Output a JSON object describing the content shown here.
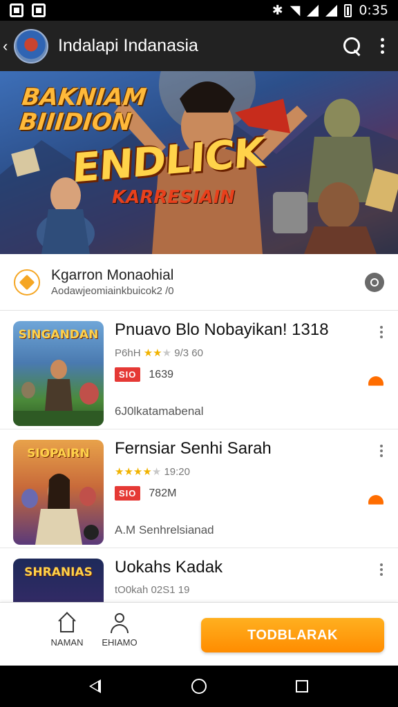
{
  "status_bar": {
    "time": "0:35",
    "icons": [
      "notification-icon",
      "notification-icon",
      "bluetooth-icon",
      "wifi-icon",
      "signal-icon",
      "signal-icon",
      "battery-icon"
    ]
  },
  "app_bar": {
    "title": "Indalapi Indanasia",
    "icons": [
      "back-icon",
      "app-avatar",
      "search-icon",
      "more-vert-icon"
    ]
  },
  "banner": {
    "tagline": "BAKNIAM BIIIDION",
    "title": "ENDLICK",
    "subtitle": "KARRESIAIN"
  },
  "developer": {
    "name": "Kgarron Monaohial",
    "subtitle": "Aodawjeomiainkbuicok2 /0",
    "icons": [
      "dev-logo-icon",
      "eye-icon"
    ]
  },
  "games": [
    {
      "title": "Pnuavo Blo Nobayikan! 1318",
      "thumb_logo": "SINGANDAN",
      "rating_text": "P6hH",
      "rating_value": "9/3 60",
      "stars": 2,
      "badge": "SIO",
      "size": "1639",
      "desc": "6J0lkatamabenal"
    },
    {
      "title": "Fernsiar Senhi Sarah",
      "thumb_logo": "SIOPAIRN",
      "rating_text": "",
      "rating_value": "19:20",
      "stars": 4,
      "badge": "SIO",
      "size": "782M",
      "desc": "A.M Senhrelsianad"
    },
    {
      "title": "Uokahs Kadak",
      "thumb_logo": "SHRANIAS",
      "rating_text": "tO0kah",
      "rating_value": "02S1 19",
      "stars": 0,
      "badge": "",
      "size": "",
      "desc": ""
    }
  ],
  "bottom_bar": {
    "tab_home": "NAMAN",
    "tab_profile": "EHIAMO",
    "cta": "TODBLARAK",
    "icons": [
      "home-icon",
      "person-icon"
    ]
  },
  "colors": {
    "accent": "#ff8c00",
    "badge_red": "#e53935",
    "star": "#f1b300",
    "app_bar": "#222222"
  }
}
